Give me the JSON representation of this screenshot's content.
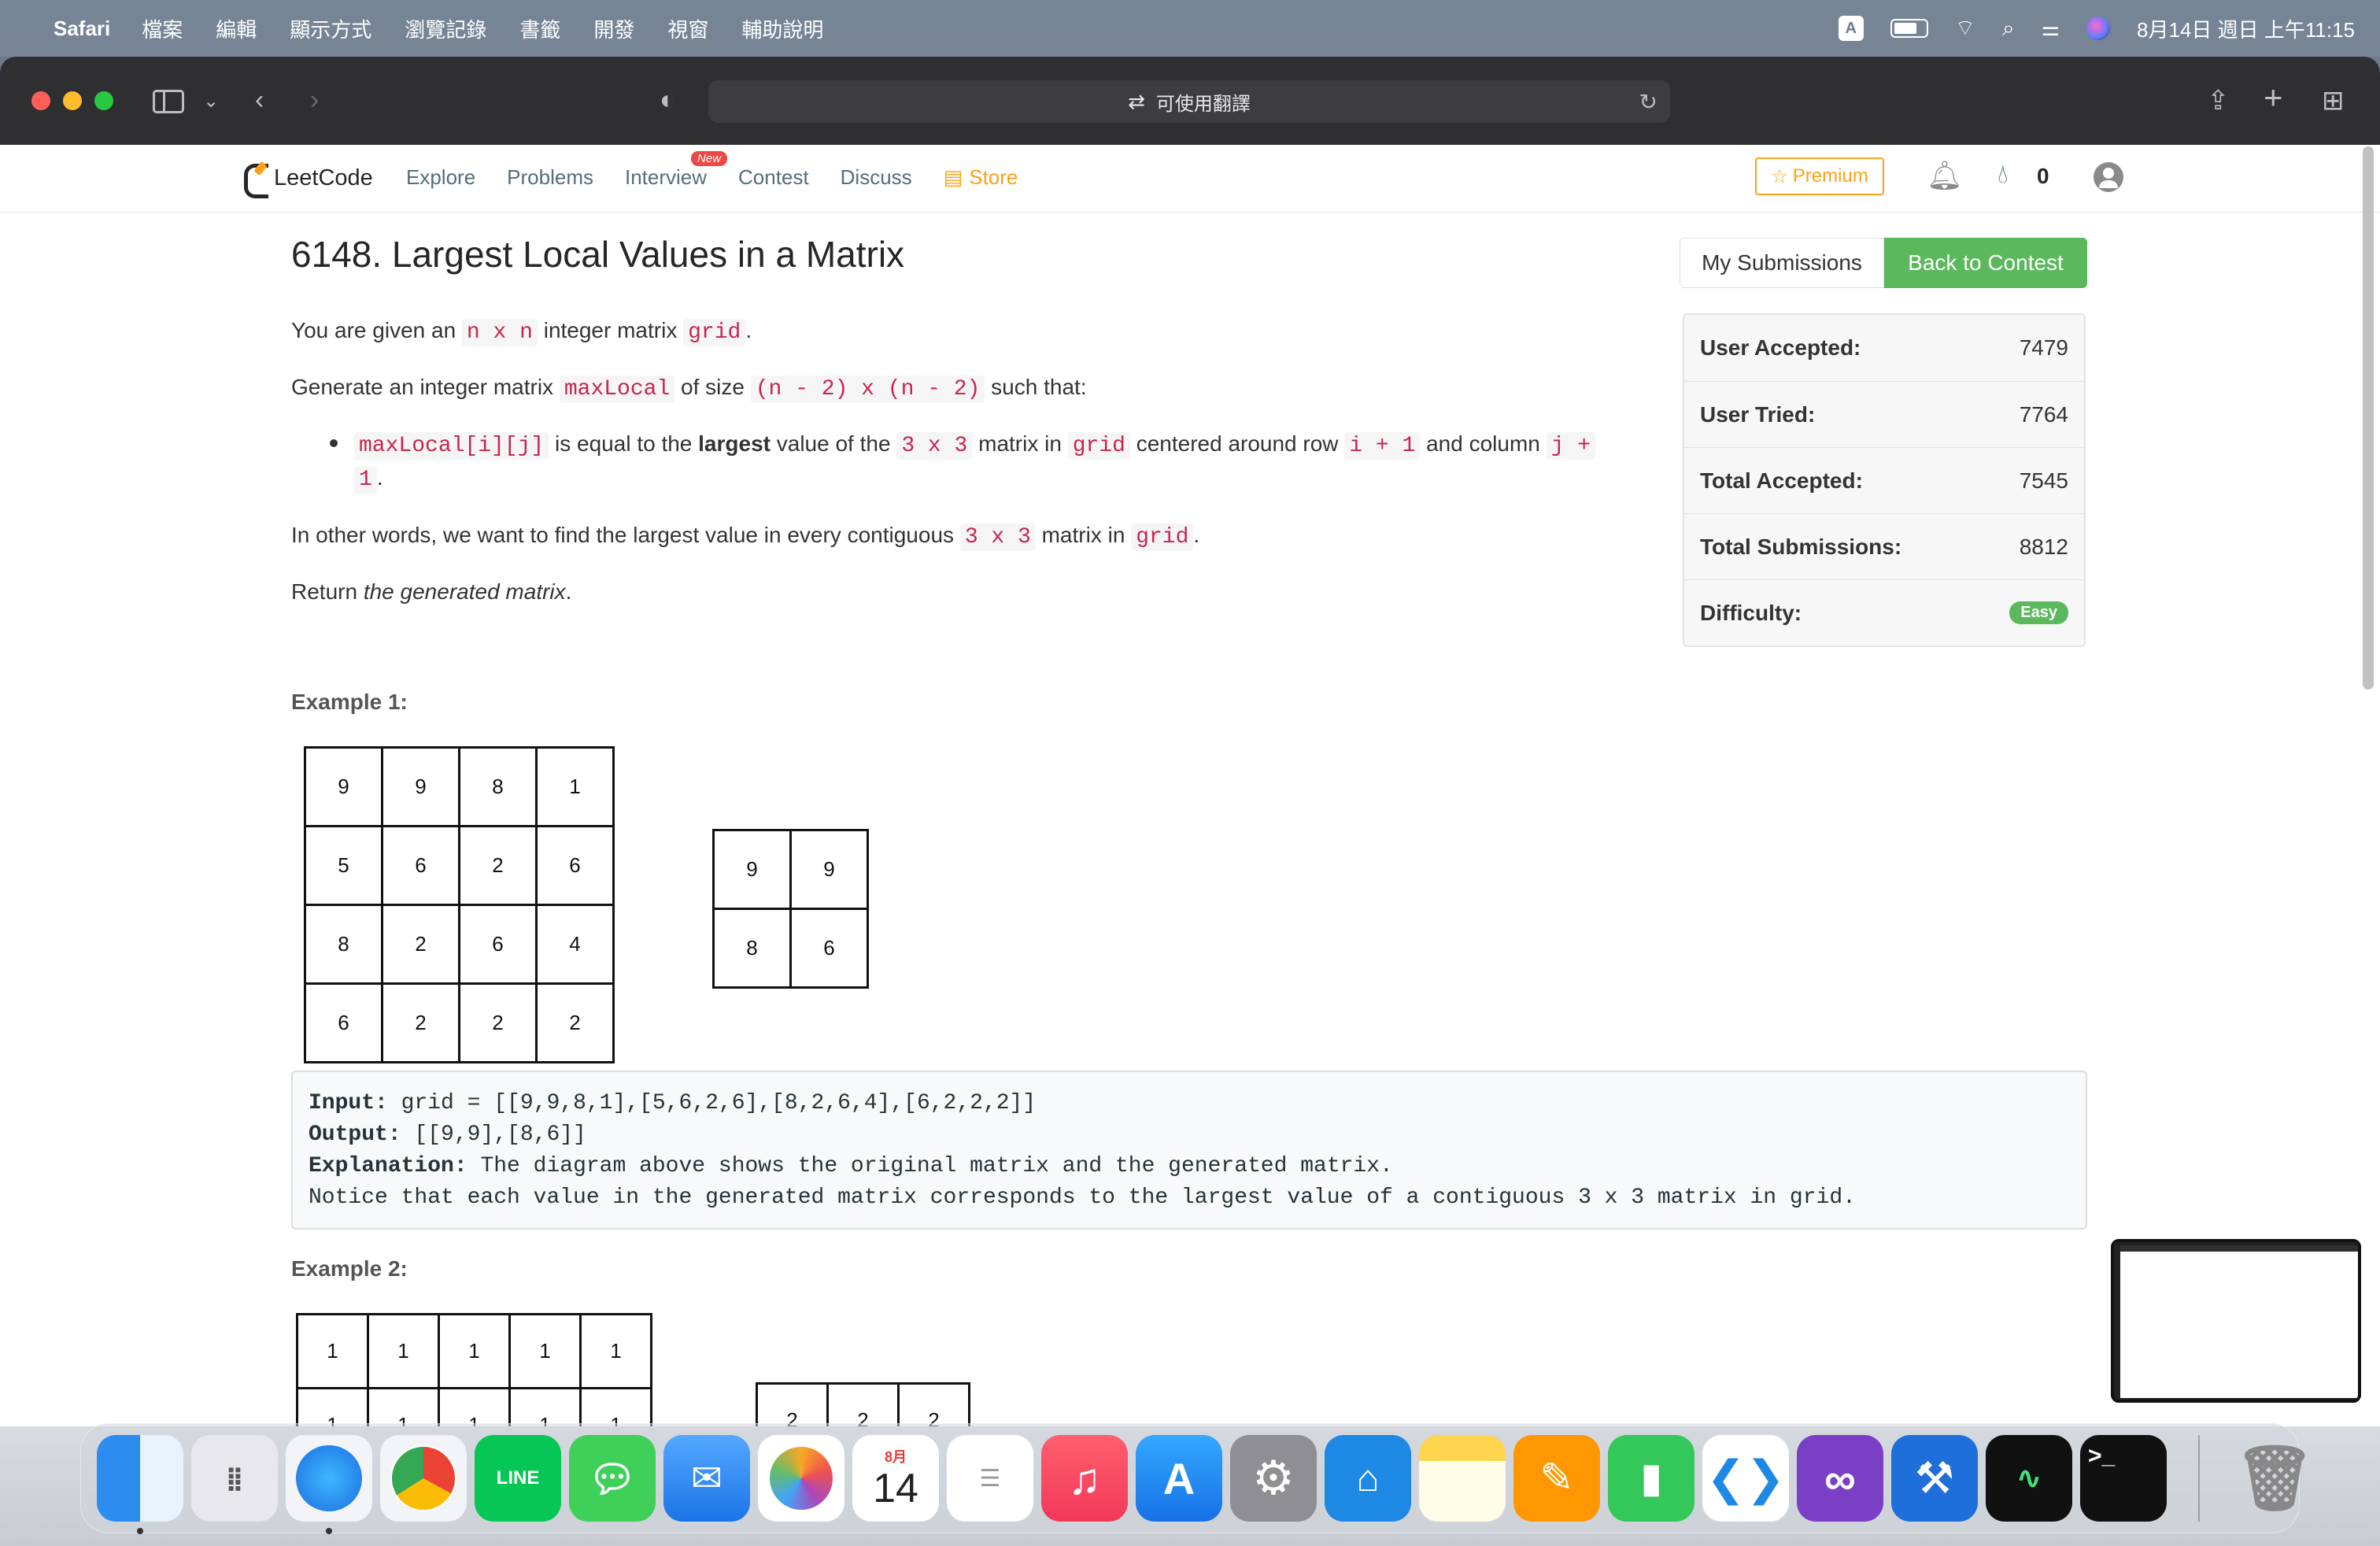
{
  "menubar": {
    "app_name": "Safari",
    "items": [
      "檔案",
      "編輯",
      "顯示方式",
      "瀏覽記錄",
      "書籤",
      "開發",
      "視窗",
      "輔助說明"
    ],
    "input_indicator": "A",
    "datetime": "8月14日 週日 上午11:15"
  },
  "browser": {
    "address_text": "可使用翻譯"
  },
  "nav": {
    "logo_text": "LeetCode",
    "links": [
      "Explore",
      "Problems",
      "Interview",
      "Contest",
      "Discuss"
    ],
    "new_badge": "New",
    "store": "Store",
    "premium": "Premium",
    "streak": "0"
  },
  "problem": {
    "title": "6148. Largest Local Values in a Matrix",
    "p1": {
      "t1": "You are given an ",
      "c1": "n x n",
      "t2": " integer matrix ",
      "c2": "grid",
      "t3": "."
    },
    "p2": {
      "t1": "Generate an integer matrix ",
      "c1": "maxLocal",
      "t2": " of size ",
      "c2": "(n - 2) x (n - 2)",
      "t3": " such that:"
    },
    "bullet": {
      "c1": "maxLocal[i][j]",
      "t1": " is equal to the ",
      "b1": "largest",
      "t2": " value of the ",
      "c2": "3 x 3",
      "t3": " matrix in ",
      "c3": "grid",
      "t4": " centered around row ",
      "c4": "i + 1",
      "t5": " and column ",
      "c5": "j +",
      "c6": "1",
      "t6": "."
    },
    "p3": {
      "t1": "In other words, we want to find the largest value in every contiguous ",
      "c1": "3 x 3",
      "t2": " matrix in ",
      "c2": "grid",
      "t3": "."
    },
    "p4": {
      "t1": "Return ",
      "i1": "the generated matrix",
      "t2": "."
    }
  },
  "sidebar": {
    "my_submissions": "My Submissions",
    "back_to_contest": "Back to Contest",
    "stats": [
      {
        "label": "User Accepted:",
        "value": "7479"
      },
      {
        "label": "User Tried:",
        "value": "7764"
      },
      {
        "label": "Total Accepted:",
        "value": "7545"
      },
      {
        "label": "Total Submissions:",
        "value": "8812"
      },
      {
        "label": "Difficulty:",
        "value": "Easy"
      }
    ]
  },
  "example1": {
    "label": "Example 1:",
    "input_grid": [
      [
        "9",
        "9",
        "8",
        "1"
      ],
      [
        "5",
        "6",
        "2",
        "6"
      ],
      [
        "8",
        "2",
        "6",
        "4"
      ],
      [
        "6",
        "2",
        "2",
        "2"
      ]
    ],
    "output_grid": [
      [
        "9",
        "9"
      ],
      [
        "8",
        "6"
      ]
    ],
    "input_label": "Input:",
    "input_text": " grid = [[9,9,8,1],[5,6,2,6],[8,2,6,4],[6,2,2,2]]",
    "output_label": "Output:",
    "output_text": " [[9,9],[8,6]]",
    "explanation_label": "Explanation:",
    "explanation_text": " The diagram above shows the original matrix and the generated matrix.",
    "explanation_line2": "Notice that each value in the generated matrix corresponds to the largest value of a contiguous 3 x 3 matrix in grid."
  },
  "example2": {
    "label": "Example 2:",
    "input_row1": [
      "1",
      "1",
      "1",
      "1",
      "1"
    ],
    "input_row2": [
      "1",
      "1",
      "1",
      "1",
      "1"
    ],
    "output_row1": [
      "2",
      "2",
      "2"
    ]
  },
  "dock": {
    "calendar_month": "8月",
    "calendar_day": "14",
    "apps": [
      "Finder",
      "Launchpad",
      "Safari",
      "Chrome",
      "LINE",
      "Messages",
      "Mail",
      "Photos",
      "Calendar",
      "Reminders",
      "Music",
      "App Store",
      "System Preferences",
      "Keynote",
      "Notes",
      "Pages",
      "Numbers",
      "VS Code",
      "Visual Studio",
      "Xcode",
      "Activity Monitor",
      "Terminal",
      "Trash"
    ]
  }
}
